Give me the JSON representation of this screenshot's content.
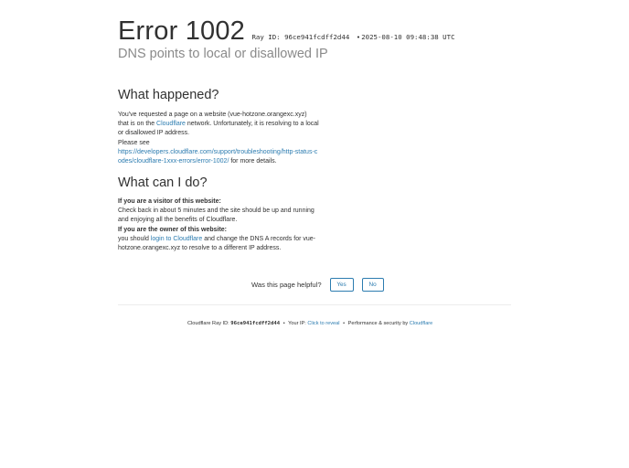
{
  "header": {
    "error_title": "Error 1002",
    "ray_label": "Ray ID:",
    "ray_id": "96ce941fcdff2d44",
    "bullet": "•",
    "timestamp": "2025-08-10 09:48:38 UTC",
    "subtitle": "DNS points to local or disallowed IP"
  },
  "what_happened": {
    "title": "What happened?",
    "p1_text_a": "You've requested a page on a website (vue-hotzone.orangexc.xyz) that is on the ",
    "p1_link": "Cloudflare",
    "p1_text_b": " network. Unfortunately, it is resolving to a local or disallowed IP address.",
    "p2_text_a": "Please see",
    "p2_link": "https://developers.cloudflare.com/support/troubleshooting/http-status-codes/cloudflare-1xxx-errors/error-1002/",
    "p2_text_b": " for more details."
  },
  "what_can_i_do": {
    "title": "What can I do?",
    "visitor_heading": "If you are a visitor of this website:",
    "visitor_text": "Check back in about 5 minutes and the site should be up and running and enjoying all the benefits of Cloudflare.",
    "owner_heading": "If you are the owner of this website:",
    "owner_text_a": "you should ",
    "owner_link": "login to Cloudflare",
    "owner_text_b": " and change the DNS A records for vue-hotzone.orangexc.xyz to resolve to a different IP address."
  },
  "feedback": {
    "question": "Was this page helpful?",
    "yes_label": "Yes",
    "no_label": "No"
  },
  "footer": {
    "ray_label": "Cloudflare Ray ID: ",
    "ray_id": "96ce941fcdff2d44",
    "separator": "•",
    "ip_label": "Your IP: ",
    "ip_link": "Click to reveal",
    "perf_label": "Performance & security by ",
    "perf_link": "Cloudflare"
  },
  "colors": {
    "link": "#2c7cb0",
    "text": "#313131",
    "subtitle": "#8a8a8a"
  }
}
